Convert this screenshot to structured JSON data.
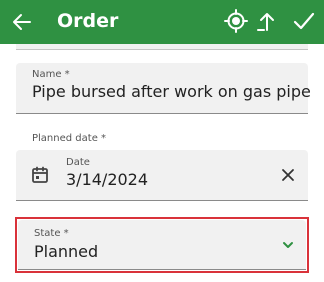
{
  "appbar": {
    "title": "Order",
    "back_icon": "arrow-left-icon",
    "actions": [
      "gps-target-icon",
      "upload-icon",
      "checkmark-icon"
    ],
    "color": "#2f9142"
  },
  "form": {
    "name": {
      "label": "Name *",
      "value": "Pipe bursed after work on gas pipe"
    },
    "planned_date": {
      "group_label": "Planned date *",
      "date_label": "Date",
      "value": "3/14/2024",
      "icons": [
        "calendar-icon",
        "close-icon"
      ]
    },
    "state": {
      "label": "State *",
      "value": "Planned",
      "icon": "chevron-down-icon",
      "highlight_color": "#d9323a",
      "chevron_color": "#2f9142"
    }
  }
}
